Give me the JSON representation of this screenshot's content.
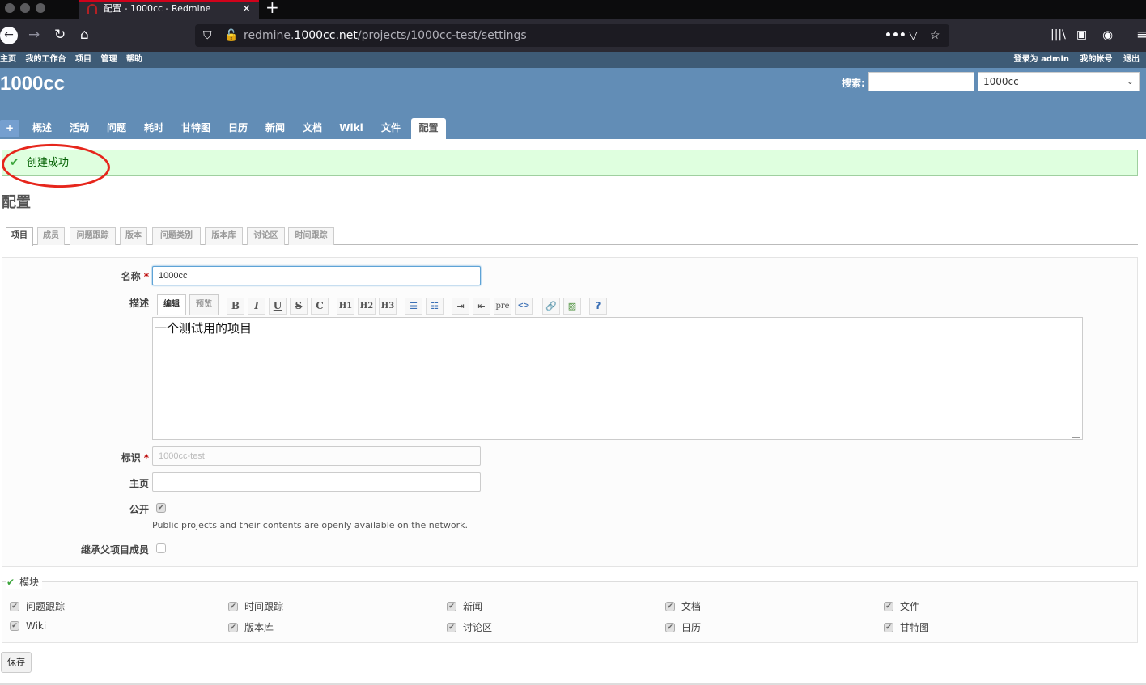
{
  "browser": {
    "tab_title": "配置 - 1000cc - Redmine",
    "url_host_prefix": "redmine.",
    "url_host_main": "1000cc.net",
    "url_path": "/projects/1000cc-test/settings"
  },
  "topmenu": {
    "left": [
      "主页",
      "我的工作台",
      "项目",
      "管理",
      "帮助"
    ],
    "logged_in_as": "登录为 admin",
    "my_account": "我的帐号",
    "logout": "退出"
  },
  "header": {
    "project_title": "1000cc",
    "search_label": "搜索:",
    "search_value": "",
    "project_jump": "1000cc"
  },
  "mainmenu": {
    "plus": "+",
    "items": [
      "概述",
      "活动",
      "问题",
      "耗时",
      "甘特图",
      "日历",
      "新闻",
      "文档",
      "Wiki",
      "文件",
      "配置"
    ],
    "selected": "配置"
  },
  "flash": {
    "notice": "创建成功"
  },
  "page": {
    "title": "配置"
  },
  "settings_tabs": [
    "项目",
    "成员",
    "问题跟踪",
    "版本",
    "问题类别",
    "版本库",
    "讨论区",
    "时间跟踪"
  ],
  "form": {
    "name_label": "名称",
    "name_value": "1000cc",
    "description_label": "描述",
    "editor_tab_edit": "编辑",
    "editor_tab_preview": "预览",
    "toolbar": [
      "B",
      "I",
      "U",
      "S",
      "C",
      "H1",
      "H2",
      "H3",
      "ul",
      "ol",
      "indent-right",
      "indent-left",
      "pre",
      "<>",
      "link",
      "image",
      "help"
    ],
    "description_value": "一个测试用的项目",
    "identifier_label": "标识",
    "identifier_value": "1000cc-test",
    "homepage_label": "主页",
    "homepage_value": "",
    "public_label": "公开",
    "public_checked": true,
    "public_hint": "Public projects and their contents are openly available on the network.",
    "inherit_label": "继承父项目成员",
    "inherit_checked": false,
    "required_mark": "*"
  },
  "modules": {
    "legend": "模块",
    "items": [
      {
        "label": "问题跟踪",
        "checked": true
      },
      {
        "label": "时间跟踪",
        "checked": true
      },
      {
        "label": "新闻",
        "checked": true
      },
      {
        "label": "文档",
        "checked": true
      },
      {
        "label": "文件",
        "checked": true
      },
      {
        "label": "Wiki",
        "checked": true
      },
      {
        "label": "版本库",
        "checked": true
      },
      {
        "label": "讨论区",
        "checked": true
      },
      {
        "label": "日历",
        "checked": true
      },
      {
        "label": "甘特图",
        "checked": true
      }
    ]
  },
  "save_button": "保存"
}
